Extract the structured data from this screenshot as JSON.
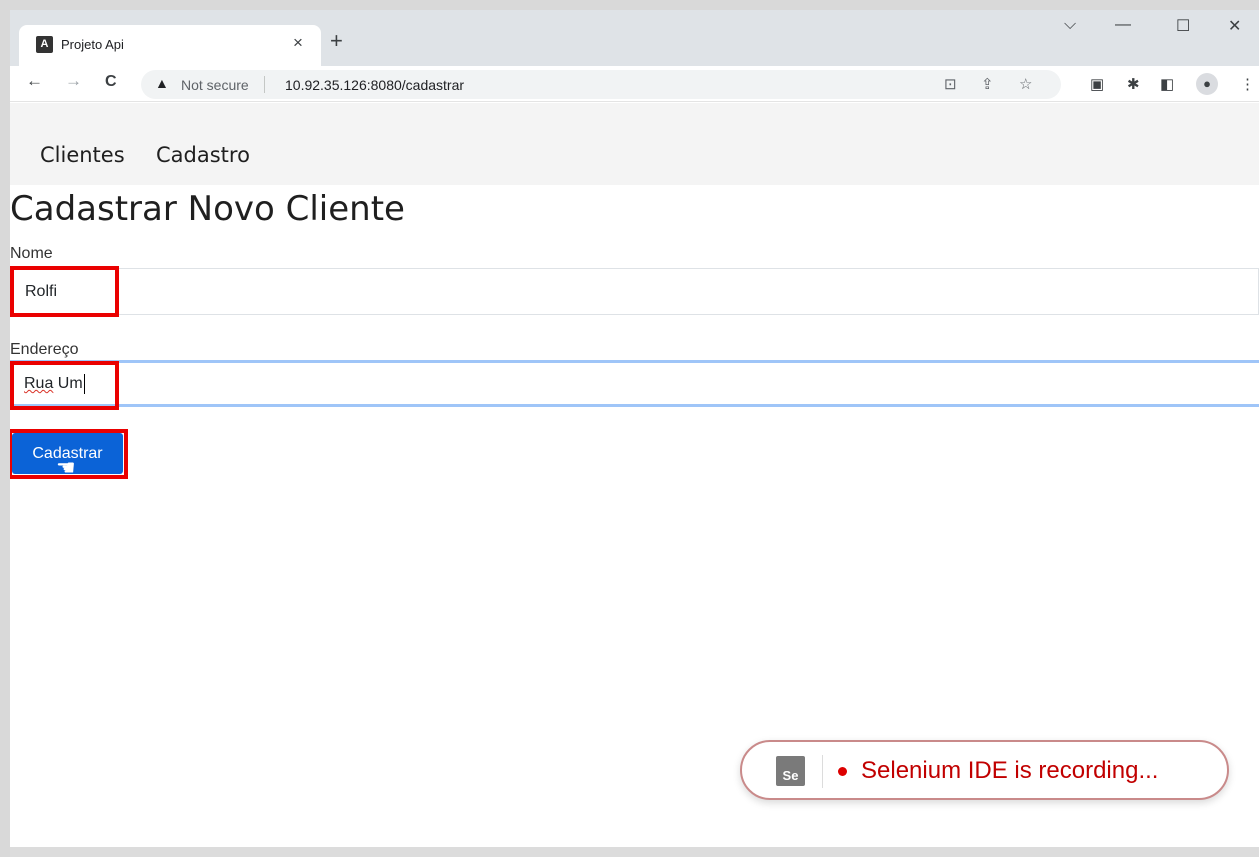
{
  "browser": {
    "tab_title": "Projeto Api",
    "tab_close": "×",
    "new_tab": "+",
    "controls": {
      "dropdown": "⌵",
      "minimize": "—",
      "maximize": "☐",
      "close": "✕"
    },
    "nav": {
      "back": "←",
      "forward": "→",
      "reload": "C"
    },
    "security_label": "Not secure",
    "url": "10.92.35.126:8080/cadastrar"
  },
  "nav": {
    "items": [
      {
        "label": "Clientes"
      },
      {
        "label": "Cadastro"
      }
    ]
  },
  "page": {
    "title": "Cadastrar Novo Cliente",
    "form": {
      "nome_label": "Nome",
      "nome_value": "Rolfi",
      "endereco_label": "Endereço",
      "endereco_value_word1": "Rua",
      "endereco_value_word2": " Um",
      "submit_label": "Cadastrar"
    }
  },
  "selenium": {
    "logo_text": "Se",
    "status": "Selenium IDE is recording..."
  },
  "colors": {
    "highlight": "#ea0000",
    "button": "#0b63d7",
    "recording": "#c10000",
    "focus_ring": "#9fc5f8"
  }
}
